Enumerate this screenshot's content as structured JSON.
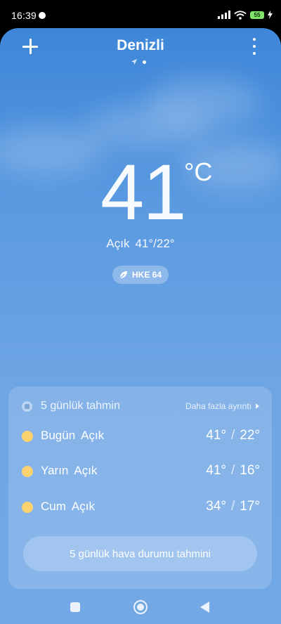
{
  "status_bar": {
    "time": "16:39",
    "battery": "55"
  },
  "header": {
    "city": "Denizli"
  },
  "current": {
    "temperature": "41",
    "unit": "°C",
    "condition": "Açık",
    "range": "41°/22°",
    "aqi": "HKE 64"
  },
  "forecast": {
    "title": "5 günlük tahmin",
    "more_label": "Daha fazla ayrıntı",
    "days": [
      {
        "day": "Bugün",
        "condition": "Açık",
        "high": "41°",
        "low": "22°"
      },
      {
        "day": "Yarın",
        "condition": "Açık",
        "high": "41°",
        "low": "16°"
      },
      {
        "day": "Cum",
        "condition": "Açık",
        "high": "34°",
        "low": "17°"
      }
    ],
    "button_label": "5 günlük hava durumu tahmini"
  },
  "colors": {
    "sky_top": "#3d86d8",
    "sky_bottom": "#72a8e6",
    "sun": "#fcd26e",
    "battery": "#7fe36a"
  }
}
